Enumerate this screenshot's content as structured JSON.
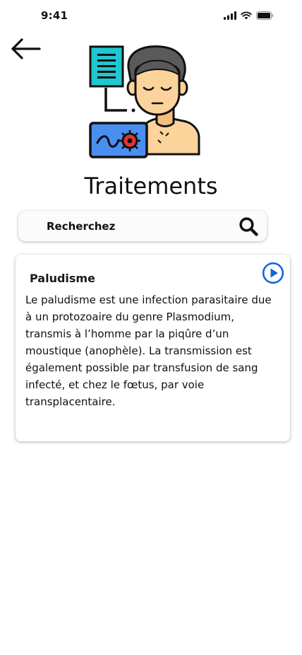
{
  "status_bar": {
    "time": "9:41",
    "icons": [
      "signal-icon",
      "wifi-icon",
      "battery-icon"
    ]
  },
  "header": {
    "back_icon": "arrow-left-icon",
    "illustration": "patient-diagnosis-illustration",
    "title": "Traitements"
  },
  "search": {
    "placeholder": "Recherchez",
    "icon": "search-icon"
  },
  "card": {
    "title": "Paludisme",
    "play_icon": "play-circle-icon",
    "description": "Le paludisme est une infection parasitaire due à un protozoaire du genre Plasmodium, transmis à l’homme par la piqûre d’un moustique (anophèle). La transmission est également possible par transfusion de sang infecté, et chez le fœtus, par voie transplacentaire."
  },
  "colors": {
    "accent": "#1565e0",
    "text": "#111111",
    "background": "#ffffff",
    "illustration_teal": "#1fc7d0",
    "illustration_skin": "#fbd39b",
    "illustration_blue": "#4a8ef0",
    "illustration_red": "#e5352f",
    "illustration_hair": "#5a5a5a"
  }
}
